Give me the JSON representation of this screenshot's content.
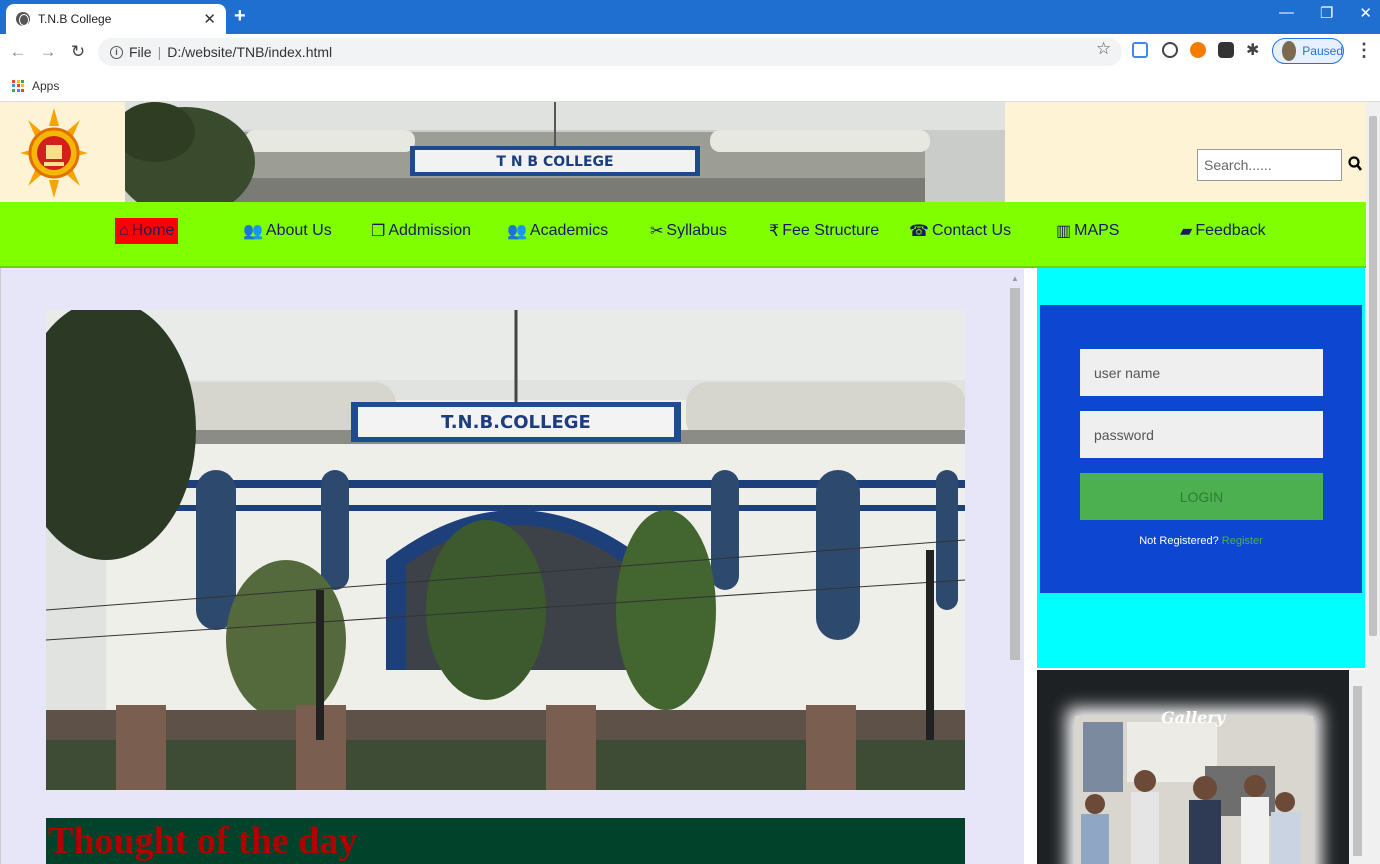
{
  "browser": {
    "tab_title": "T.N.B College",
    "url_scheme": "File",
    "url_path": "D:/website/TNB/index.html",
    "profile_label": "Paused",
    "bookmarks_apps": "Apps"
  },
  "header": {
    "search_placeholder": "Search......"
  },
  "nav": {
    "items": [
      {
        "label": "Home",
        "icon": "home-icon"
      },
      {
        "label": "About Us",
        "icon": "users-icon"
      },
      {
        "label": "Addmission",
        "icon": "copy-icon"
      },
      {
        "label": "Academics",
        "icon": "users-icon"
      },
      {
        "label": "Syllabus",
        "icon": "scissors-icon"
      },
      {
        "label": "Fee Structure",
        "icon": "rupee-icon"
      },
      {
        "label": "Contact Us",
        "icon": "phone-icon"
      },
      {
        "label": "MAPS",
        "icon": "map-icon"
      },
      {
        "label": "Feedback",
        "icon": "book-icon"
      }
    ]
  },
  "main": {
    "thought_title": "Thought of the day"
  },
  "login": {
    "username_placeholder": "user name",
    "password_placeholder": "password",
    "button_label": "LOGIN",
    "not_registered": "Not Registered?",
    "register_link": "Register"
  },
  "gallery": {
    "title": "Gallery"
  },
  "colors": {
    "navbar": "#80ff00",
    "active_nav": "#ff0000",
    "login_bg": "#0d47d1",
    "side_bg": "#00ffff",
    "thought_bg": "#00432a"
  }
}
